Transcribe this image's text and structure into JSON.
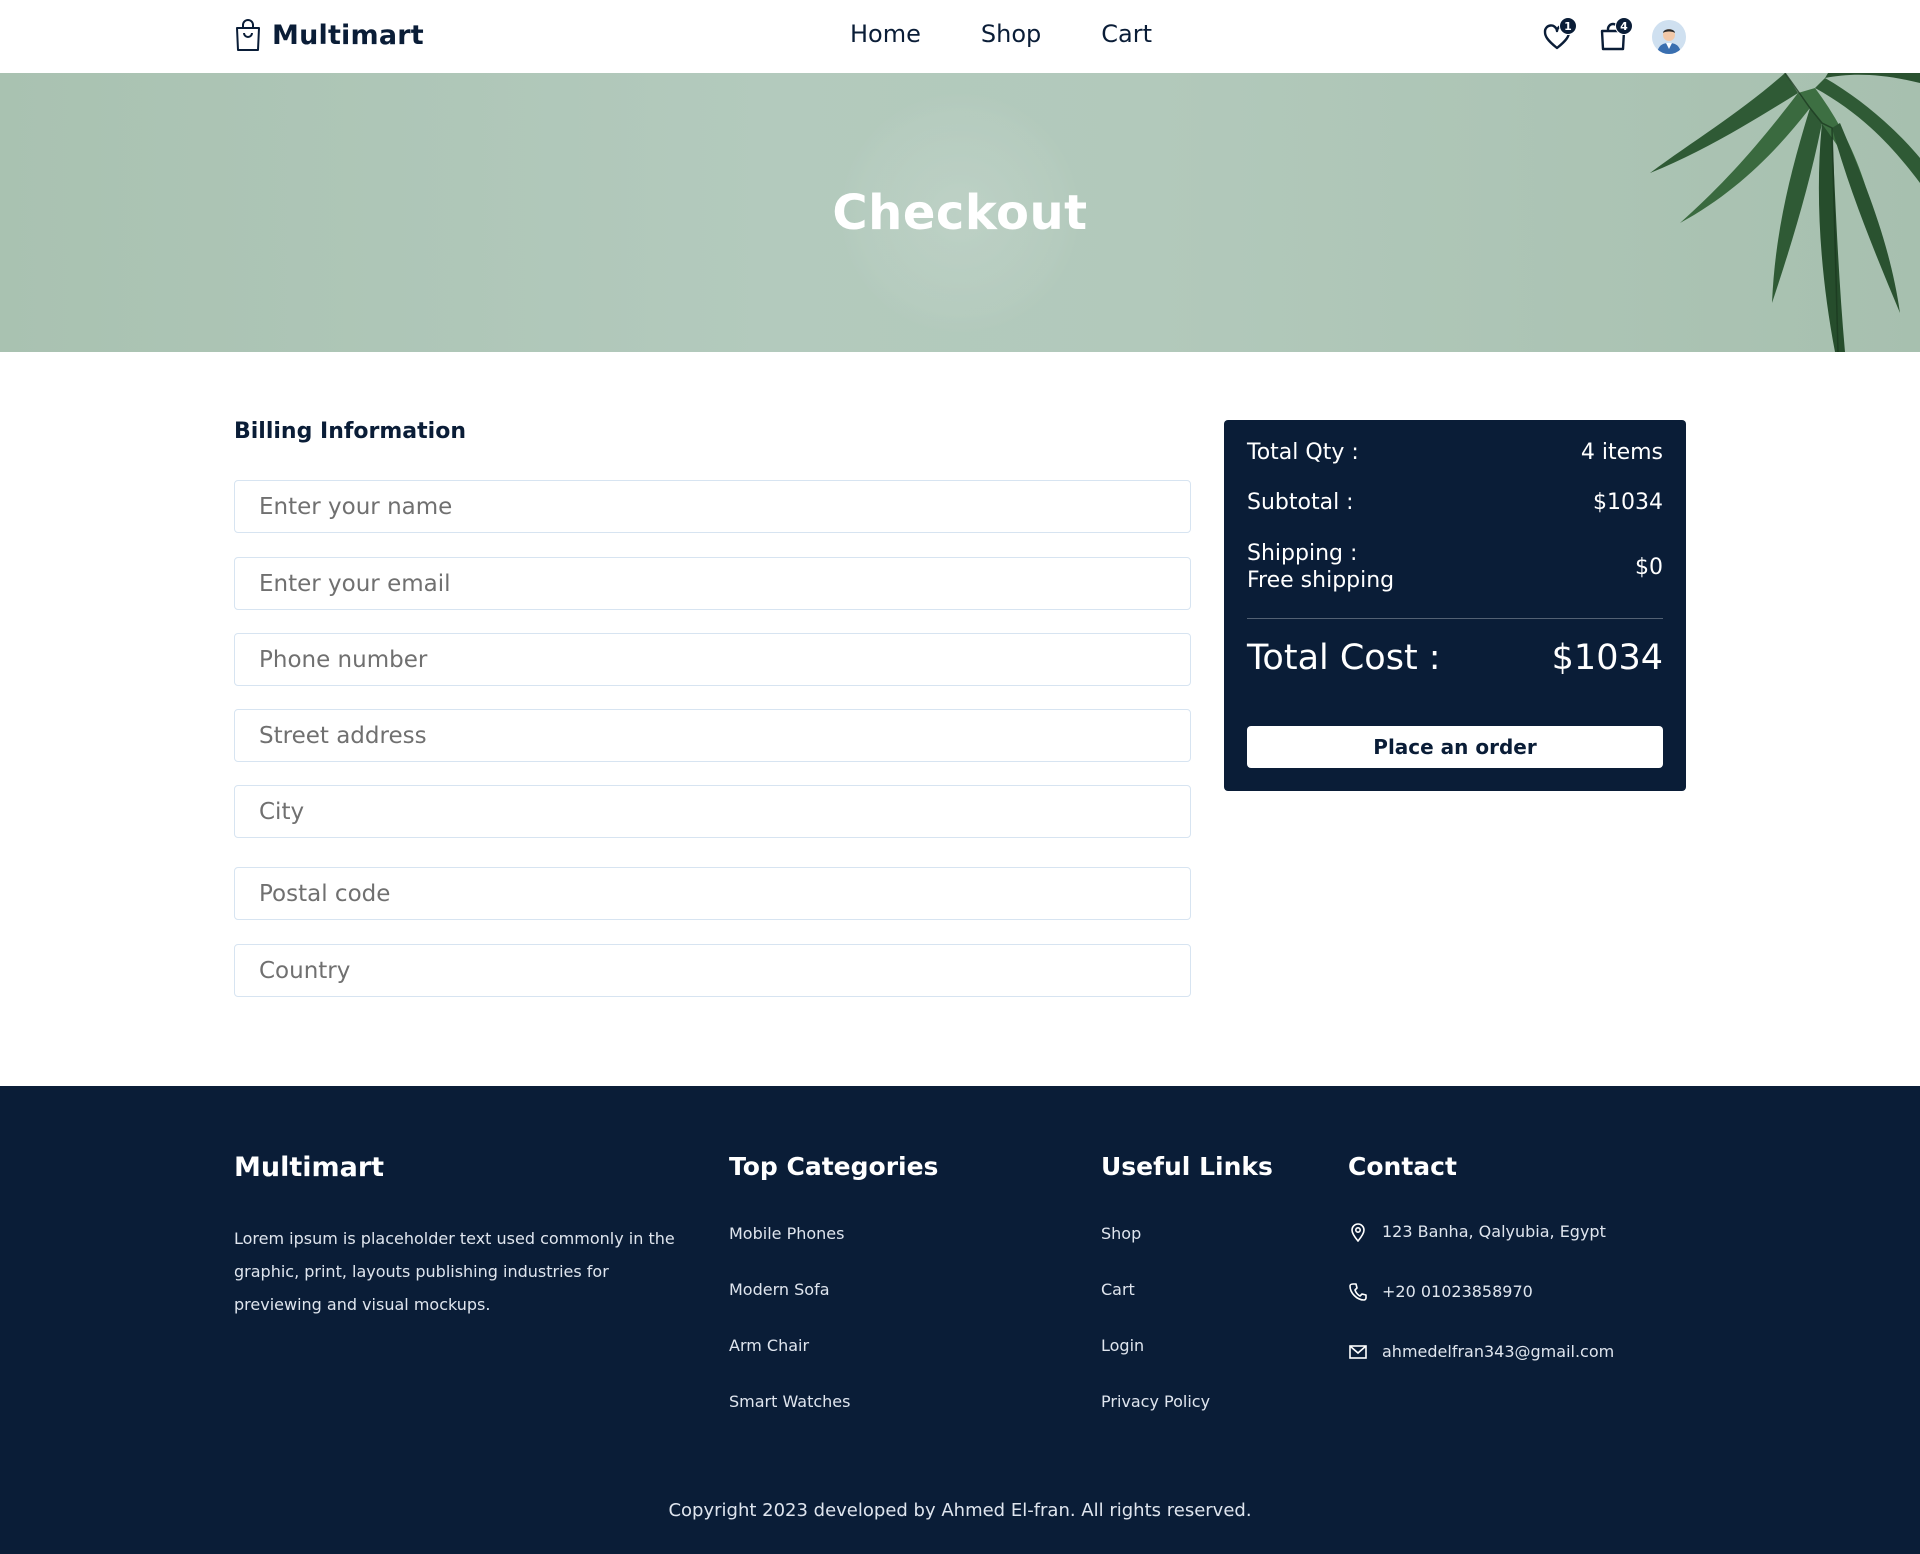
{
  "header": {
    "brand": "Multimart",
    "nav": [
      "Home",
      "Shop",
      "Cart"
    ],
    "wishlist_count": "1",
    "cart_count": "4",
    "icons": [
      "heart-icon",
      "shopping-bag-icon",
      "user-avatar"
    ]
  },
  "hero": {
    "title": "Checkout"
  },
  "billing": {
    "title": "Billing Information",
    "fields": {
      "name": "Enter your name",
      "email": "Enter your email",
      "phone": "Phone number",
      "street": "Street address",
      "city": "City",
      "postal": "Postal code",
      "country": "Country"
    }
  },
  "summary": {
    "qty_label": "Total Qty :",
    "qty_value": "4 items",
    "subtotal_label": "Subtotal :",
    "subtotal_value": "$1034",
    "shipping_label": "Shipping :",
    "shipping_note": "Free shipping",
    "shipping_value": "$0",
    "total_label": "Total Cost :",
    "total_value": "$1034",
    "order_button": "Place an order"
  },
  "footer": {
    "brand": "Multimart",
    "description": "Lorem ipsum is placeholder text used commonly in the graphic, print, layouts publishing industries for previewing and visual mockups.",
    "categories_title": "Top Categories",
    "categories": [
      "Mobile Phones",
      "Modern Sofa",
      "Arm Chair",
      "Smart Watches"
    ],
    "links_title": "Useful Links",
    "links": [
      "Shop",
      "Cart",
      "Login",
      "Privacy Policy"
    ],
    "contact_title": "Contact",
    "address": "123 Banha, Qalyubia, Egypt",
    "phone": "+20 01023858970",
    "email": "ahmedelfran343@gmail.com",
    "copyright": "Copyright 2023 developed by Ahmed El-fran. All rights reserved."
  },
  "colors": {
    "primary": "#0a1d37",
    "hero_bg": "#b0c8b8",
    "white": "#ffffff"
  }
}
